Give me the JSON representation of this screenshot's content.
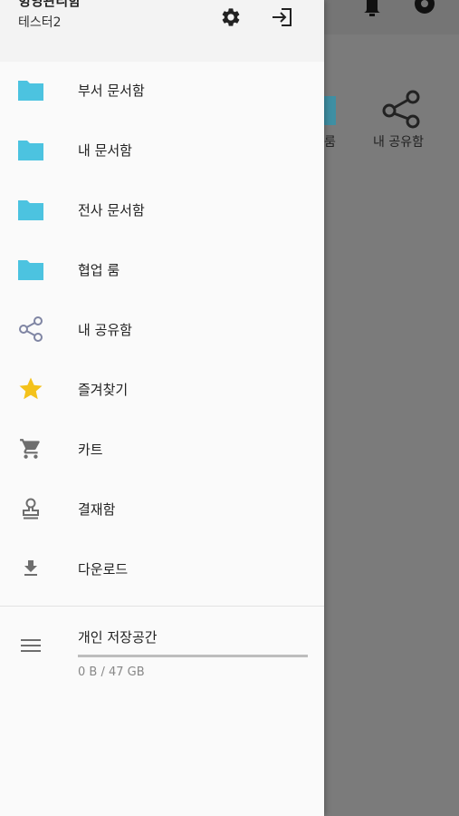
{
  "header": {
    "user_name": "헝영관리함",
    "user_subtitle": "테스터2",
    "settings_icon": "gear-icon",
    "logout_icon": "login-icon"
  },
  "menu": [
    {
      "label": "부서 문서함",
      "icon": "folder-icon",
      "color": "#4cc3e0"
    },
    {
      "label": "내 문서함",
      "icon": "folder-icon",
      "color": "#4cc3e0"
    },
    {
      "label": "전사 문서함",
      "icon": "folder-icon",
      "color": "#4cc3e0"
    },
    {
      "label": "협업 룸",
      "icon": "folder-icon",
      "color": "#4cc3e0"
    },
    {
      "label": "내 공유함",
      "icon": "share-icon",
      "color": "#7f85a3"
    },
    {
      "label": "즐겨찾기",
      "icon": "star-icon",
      "color": "#f4c21b"
    },
    {
      "label": "카트",
      "icon": "cart-icon",
      "color": "#6e6e6e"
    },
    {
      "label": "결재함",
      "icon": "stamp-icon",
      "color": "#6e6e6e"
    },
    {
      "label": "다운로드",
      "icon": "download-icon",
      "color": "#6e6e6e"
    }
  ],
  "storage": {
    "title": "개인 저장공간",
    "usage": "0 B / 47 GB",
    "used_fraction": 0,
    "icon": "menu-lines-icon"
  },
  "background": {
    "label_room": "룸",
    "label_share": "내 공유함"
  }
}
